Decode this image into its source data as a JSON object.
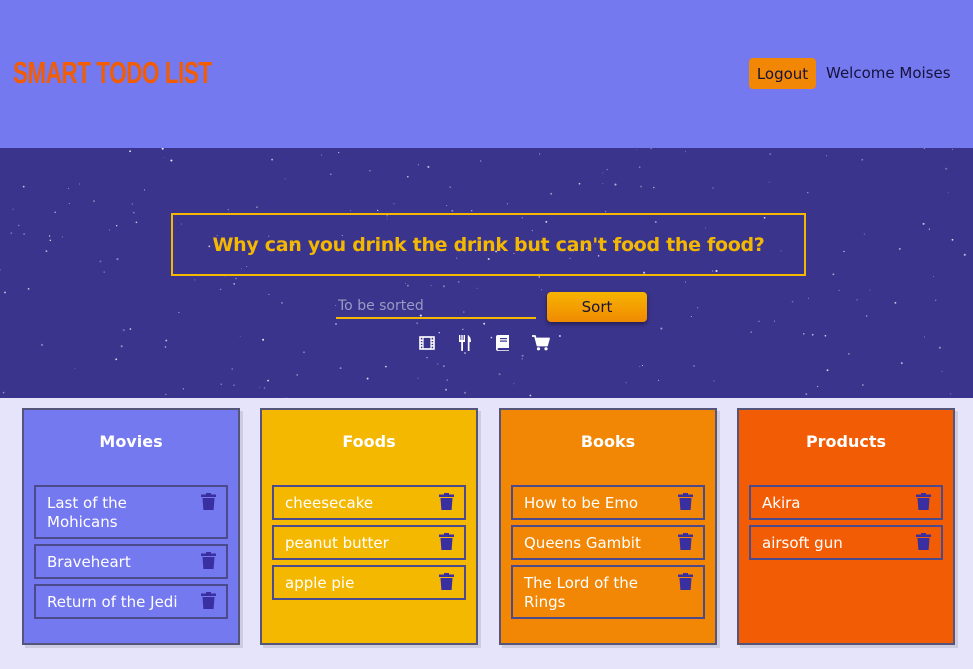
{
  "header": {
    "logo": "SMART TODO LIST",
    "logout_label": "Logout",
    "welcome_text": "Welcome Moises"
  },
  "hero": {
    "quote": "Why can you drink the drink but can't food the food?",
    "input_placeholder": "To be sorted",
    "sort_label": "Sort",
    "category_icons": [
      "film-icon",
      "utensils-icon",
      "book-icon",
      "shopping-cart-icon"
    ]
  },
  "columns": [
    {
      "title": "Movies",
      "color": "#7579ef",
      "items": [
        "Last of the Mohicans",
        "Braveheart",
        "Return of the Jedi"
      ]
    },
    {
      "title": "Foods",
      "color": "#f5b800",
      "items": [
        "cheesecake",
        "peanut butter",
        "apple pie"
      ]
    },
    {
      "title": "Books",
      "color": "#f18705",
      "items": [
        "How to be Emo",
        "Queens Gambit",
        "The Lord of the Rings"
      ]
    },
    {
      "title": "Products",
      "color": "#f25c05",
      "items": [
        "Akira",
        "airsoft gun"
      ]
    }
  ],
  "colors": {
    "header_bg": "#7579ef",
    "hero_bg": "#3b348c",
    "accent": "#f5b800",
    "logo": "#f25c05",
    "icon": "#3a2fa0"
  }
}
